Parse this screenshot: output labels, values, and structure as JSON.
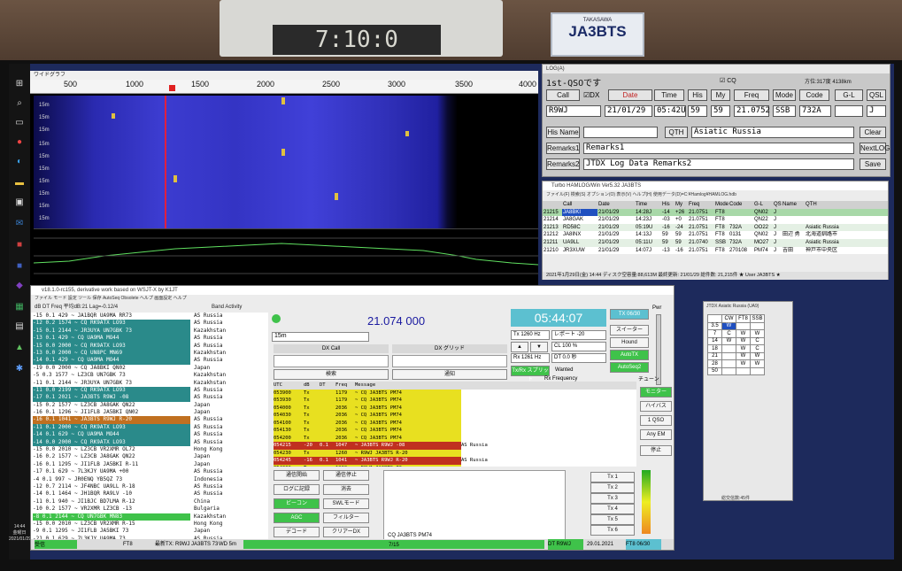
{
  "room": {
    "clock_display": "7:10:0",
    "plate_small": "TAKASAWA",
    "plate_call": "JA3BTS"
  },
  "taskbar": {
    "icons": [
      "windows-logo",
      "search",
      "task-view",
      "chrome",
      "edge",
      "explorer",
      "store",
      "mail",
      "app",
      "app",
      "app",
      "app",
      "app",
      "app",
      "app"
    ],
    "clock_time": "14:44",
    "clock_day": "金曜日",
    "clock_date": "2021/01/29"
  },
  "waterfall": {
    "title": "ワイドグラフ",
    "ticks": [
      "500",
      "1000",
      "1500",
      "2000",
      "2500",
      "3000",
      "3500",
      "4000"
    ],
    "band_labels": [
      "15m",
      "15m",
      "15m",
      "15m",
      "15m",
      "15m",
      "15m",
      "15m",
      "15m",
      "15m"
    ]
  },
  "log": {
    "title": "LOG(A)",
    "subtitle": "1st-QSOです",
    "status_right": "方位:317度 4138km",
    "buttons": {
      "call": "Call",
      "dx": "DX",
      "date": "Date",
      "time": "Time",
      "his": "His",
      "my": "My",
      "freq": "Freq",
      "mode": "Mode",
      "code": "Code",
      "gl": "G-L",
      "qsl": "QSL",
      "his_name": "His Name",
      "qth": "QTH",
      "clear": "Clear",
      "remarks1": "Remarks1",
      "remarks2": "Remarks2",
      "nextlog": "NextLOG",
      "save": "Save"
    },
    "cq_check": "CQ",
    "fields": {
      "call": "R9WJ",
      "date": "21/01/29",
      "time": "05:42U",
      "his": "59",
      "my": "59",
      "freq": "21.0752",
      "mode": "SSB",
      "code": "732A",
      "gl": "",
      "qsl": "J",
      "his_name": "",
      "qth": "Asiatic Russia",
      "remarks1": "Remarks1",
      "remarks2": "JTDX Log Data Remarks2"
    }
  },
  "hamlog": {
    "title": "Turbo HAMLOG/Win Ver5.32 JA3BTS",
    "menu": "ファイル(F)   検索(S)   オプション(O)   表示(V)   ヘルプ(H)   使用データ(D)=C:¥Hamlog¥HAMLOG.hdb",
    "headers": [
      "",
      "Call",
      "Date",
      "Time",
      "His",
      "My",
      "Freq",
      "Mode",
      "Code",
      "G-L",
      "QSL",
      "Name",
      "QTH"
    ],
    "rows": [
      [
        "21215",
        "JA8BKI",
        "21/01/29",
        "14:28J",
        "-14",
        "+26",
        "21.0751",
        "FT8",
        "",
        "QN02",
        "J",
        "",
        ""
      ],
      [
        "21214",
        "JA8GAK",
        "21/01/29",
        "14:23J",
        "-03",
        "+0",
        "21.0751",
        "FT8",
        "",
        "QN22",
        "J",
        "",
        ""
      ],
      [
        "21213",
        "RD58C",
        "21/01/29",
        "05:19U",
        "-16",
        "-24",
        "21.0751",
        "FT8",
        "732A",
        "OO22",
        "J",
        "",
        "Asiatic Russia"
      ],
      [
        "21212",
        "JA8INX",
        "21/01/29",
        "14:13J",
        "59",
        "59",
        "21.0751",
        "FT8",
        "0131",
        "QN02",
        "J",
        "田辺 勇",
        "北海道釧路市"
      ],
      [
        "21211",
        "UA9LL",
        "21/01/29",
        "05:11U",
        "59",
        "59",
        "21.0740",
        "SSB",
        "732A",
        "MO27",
        "J",
        "",
        "Asiatic Russia"
      ],
      [
        "21210",
        "JR3XUW",
        "21/01/29",
        "14:07J",
        "-13",
        "-16",
        "21.0751",
        "FT8",
        "270108",
        "PM74",
        "J",
        "吉田",
        "神戸市中央区"
      ]
    ],
    "status": "2021年1月29日(金)   14:44   ディスク空容量:88,613M   最終更新: 21/01/29   総件数: 21,215件   ★ User JA3BTS ★"
  },
  "jtdx": {
    "title": "v18.1.0-rc155, derivative work based on WSJT-X by K1JT",
    "menu": "ファイル  モード  設定  ツール  保存  AutoSeq  Obsolete  ヘルプ  画面設定  ヘルプ",
    "band_activity_header": "dB   DT Freq  平均dB:21 Lag=-0.12/4",
    "band_activity_label": "Band Activity",
    "frequency": "21.074 000",
    "utc_time": "05:44:07",
    "band": "15m",
    "band_rows": [
      [
        "-15  0.1  429 ~ JA1BQR UA9MA RR73",
        "AS Russia",
        ""
      ],
      [
        "-12  0.2 1574 ~ CQ RK9ATX LO93",
        "AS Russia",
        "teal"
      ],
      [
        "-15  0.1 2144 ~ JR3UYA UN7GBK 73",
        "Kazakhstan",
        "teal"
      ],
      [
        "-13  0.1  429 ~ CQ UA9MA MO44",
        "AS Russia",
        "teal"
      ],
      [
        "-15  0.0 2000 ~ CQ RK9ATX LO93",
        "AS Russia",
        "teal"
      ],
      [
        "-13  0.0 2000 ~ CQ UN8PC MN69",
        "Kazakhstan",
        "teal"
      ],
      [
        "-14  0.1  429 ~ CQ UA9MA MO44",
        "AS Russia",
        "teal"
      ],
      [
        "-19  0.0 2000 ~ CQ JA8BKI QN02",
        "Japan",
        ""
      ],
      [
        " -5  0.3 1577 ~ LZ3CB UN7GBK 73",
        "Kazakhstan",
        ""
      ],
      [
        "-11  0.1 2144 ~ JR3UYA UN7GBK 73",
        "Kazakhstan",
        ""
      ],
      [
        "-11  0.0 2199 ~ CQ RK9ATX LO93",
        "AS Russia",
        "teal"
      ],
      [
        "-17  0.1 2021 ~ JA3BTS R9WJ -08",
        "AS Russia",
        "teal"
      ],
      [
        "-15  0.2 1577 ~ LZ3CB JA8GAK QN22",
        "Japan",
        ""
      ],
      [
        "-16  0.1 1296 ~ JI1FLB JA5BKI QN02",
        "Japan",
        ""
      ],
      [
        "-16  0.1 1041 ~ JA3BTS R9WJ R-20",
        "AS Russia",
        "orange"
      ],
      [
        "-11  0.1 2000 ~ CQ RK9ATX LO93",
        "AS Russia",
        "teal"
      ],
      [
        "-14  0.1  629 ~ CQ UA9MA MO44",
        "AS Russia",
        "teal"
      ],
      [
        "-14  0.0 2000 ~ CQ RK9ATX LO93",
        "AS Russia",
        "teal"
      ],
      [
        "-15  0.0 2010 ~ LZ3CB VR2XMR OL72",
        "Hong Kong",
        ""
      ],
      [
        "-16  0.2 1577 ~ LZ3CB JA8GAK QN22",
        "Japan",
        ""
      ],
      [
        "-16  0.1 1295 ~ JI1FLB JA5BKI R-11",
        "Japan",
        ""
      ],
      [
        "-17  0.1  629 ~ 7L3KJY UA9MA +00",
        "AS Russia",
        ""
      ],
      [
        " -4  0.1  997 ~ JR0ENQ YB5QZ 73",
        "Indonesia",
        ""
      ],
      [
        "-12  0.7 2114 ~ JF4NBC UA9LL R-18",
        "AS Russia",
        ""
      ],
      [
        "-14  0.1 1464 ~ JH1BQR RA9LV -10",
        "AS Russia",
        ""
      ],
      [
        "-11  0.1  940 ~ JI1BJC BD7LMA R-12",
        "China",
        ""
      ],
      [
        "-10  0.2 1577 ~ VR2XMR LZ3CB -13",
        "Bulgaria",
        ""
      ],
      [
        " -8  0.1 2144 ~ CQ UN7GBK MN83",
        "Kazakhstan",
        "green"
      ],
      [
        "-15  0.0 2010 ~ LZ3CB VR2XMR R-15",
        "Hong Kong",
        ""
      ],
      [
        " -9  0.1 1295 ~ JI1FLB JA5BKI 73",
        "Japan",
        ""
      ],
      [
        "-21  0.1  629 ~ 7L3KJY UA9MA 73",
        "AS Russia",
        ""
      ]
    ],
    "dx_call_label": "DX Call",
    "dx_grid_label": "DX グリッド",
    "search_label": "検索",
    "notify_label": "通知",
    "rx_header": [
      "UTC",
      "dB",
      "DT",
      "Freq",
      "Message"
    ],
    "rx_rows": [
      [
        "053900",
        "Tx",
        "",
        "1179",
        "~ CQ JA3BTS PM74",
        "",
        "yellow"
      ],
      [
        "053930",
        "Tx",
        "",
        "1179",
        "~ CQ JA3BTS PM74",
        "",
        "yellow"
      ],
      [
        "054000",
        "Tx",
        "",
        "2036",
        "~ CQ JA3BTS PM74",
        "",
        "yellow"
      ],
      [
        "054030",
        "Tx",
        "",
        "2036",
        "~ CQ JA3BTS PM74",
        "",
        "yellow"
      ],
      [
        "054100",
        "Tx",
        "",
        "2036",
        "~ CQ JA3BTS PM74",
        "",
        "yellow"
      ],
      [
        "054130",
        "Tx",
        "",
        "2036",
        "~ CQ JA3BTS PM74",
        "",
        "yellow"
      ],
      [
        "054200",
        "Tx",
        "",
        "2036",
        "~ CQ JA3BTS PM74",
        "",
        "yellow"
      ],
      [
        "054215",
        "-20",
        "0.1",
        "1047",
        "~ JA3BTS R9WJ -08",
        "AS Russia",
        "red"
      ],
      [
        "054230",
        "Tx",
        "",
        "1260",
        "~ R9WJ JA3BTS R-20",
        "",
        "yellow"
      ],
      [
        "054245",
        "-16",
        "0.1",
        "1041",
        "~ JA3BTS R9WJ R-20",
        "AS Russia",
        "red"
      ],
      [
        "054300",
        "Tx",
        "",
        "1260",
        "~ R9WJ JA3BTS 73",
        "",
        "yellow"
      ]
    ],
    "right_buttons": [
      "モニター",
      "ハイバス",
      "1 QSO",
      "Any EM",
      "停止"
    ],
    "tx_row": [
      "TX 06/30",
      "スイーター",
      "Hound",
      "AutoTX",
      "AutoSeq2"
    ],
    "bottom_buttons_left": [
      "通信開始",
      "ログに記録",
      "ビーコン",
      "AGC",
      "デコード"
    ],
    "bottom_buttons_mid": [
      "通信停止",
      "消去",
      "SWLモード",
      "フィルター",
      "クリアーDX"
    ],
    "tx_slots": [
      "Tx 1",
      "Tx 2",
      "Tx 3",
      "Tx 4",
      "Tx 5",
      "Tx 6"
    ],
    "cq_field": "CQ JA3BTS PM74",
    "status_bar": [
      "受信",
      "FT8",
      "最新TX: R9WJ JA3BTS 73",
      "WD 5m",
      "7/15",
      "DT R9WJ",
      "29.01.2021",
      "FT8 06/30"
    ],
    "rx_freq_label": "Rx 1261 Hz",
    "tx_freq_label": "Tx 1260 Hz",
    "wanted_label": "Wanted",
    "report_label": "レポート -20",
    "cl_label": "CL 100 %",
    "dt_label": "DT 0.0 秒",
    "rx_freq_title": "Rx Frequency",
    "tune_label": "チューン",
    "pwr_label": "Pwr"
  },
  "cwpop": {
    "title": "JTDX Asiatic Russia (UA9)",
    "headers": [
      "",
      "CW",
      "FT8",
      "SSB"
    ],
    "rows": [
      [
        "3.5",
        "W",
        "",
        ""
      ],
      [
        "7",
        "C",
        "W",
        "W"
      ],
      [
        "14",
        "W",
        "W",
        "C"
      ],
      [
        "18",
        "",
        "W",
        "C"
      ],
      [
        "21",
        "",
        "W",
        "W"
      ],
      [
        "28",
        "",
        "W",
        "W"
      ],
      [
        "50",
        "",
        "",
        ""
      ]
    ],
    "footer": "総交信数:45件"
  }
}
